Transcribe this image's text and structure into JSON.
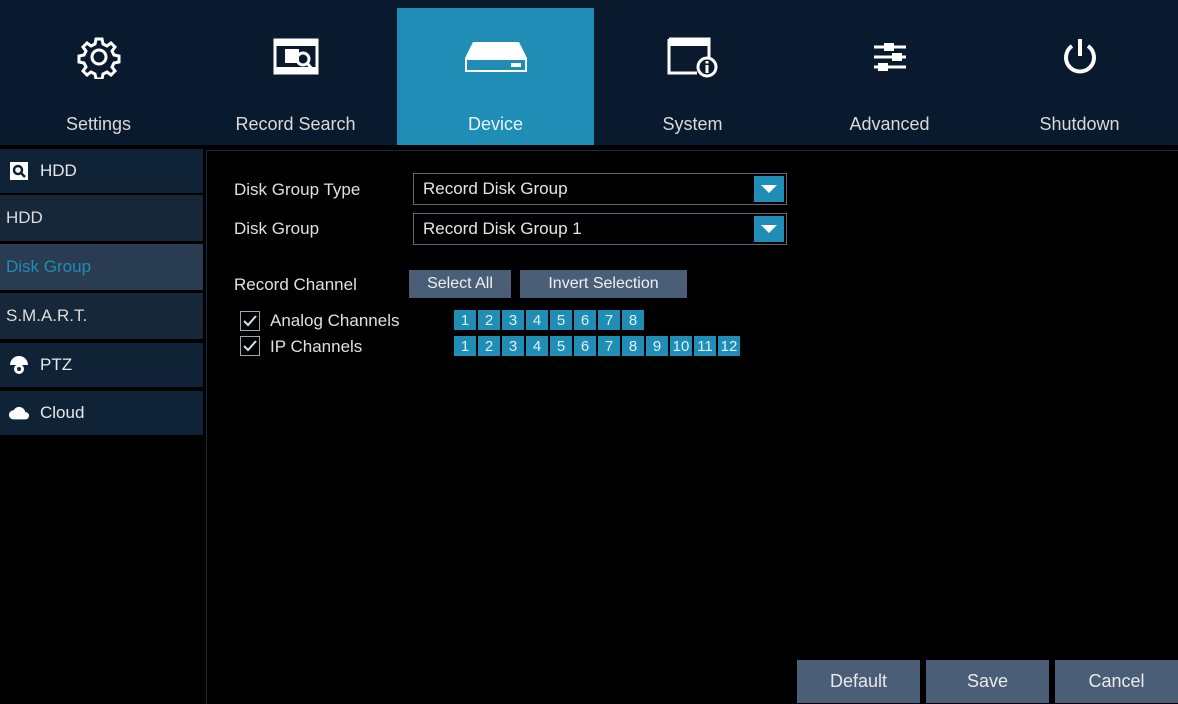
{
  "nav": {
    "tabs": [
      {
        "label": "Settings",
        "icon": "gear-icon"
      },
      {
        "label": "Record Search",
        "icon": "record-search-icon"
      },
      {
        "label": "Device",
        "icon": "hard-drive-icon"
      },
      {
        "label": "System",
        "icon": "system-info-icon"
      },
      {
        "label": "Advanced",
        "icon": "sliders-icon"
      },
      {
        "label": "Shutdown",
        "icon": "power-icon"
      }
    ],
    "active": "Device"
  },
  "sidebar": {
    "groups": [
      {
        "label": "HDD",
        "icon": "hdd-search-icon"
      },
      {
        "label": "PTZ",
        "icon": "ptz-camera-icon"
      },
      {
        "label": "Cloud",
        "icon": "cloud-icon"
      }
    ],
    "hdd_items": [
      "HDD",
      "Disk Group",
      "S.M.A.R.T."
    ],
    "active_item": "Disk Group"
  },
  "form": {
    "disk_group_type_label": "Disk Group Type",
    "disk_group_type_value": "Record Disk Group",
    "disk_group_label": "Disk Group",
    "disk_group_value": "Record Disk Group 1",
    "record_channel_label": "Record Channel",
    "select_all_label": "Select All",
    "invert_selection_label": "Invert Selection",
    "analog_label": "Analog Channels",
    "analog_checked": true,
    "analog_channels": [
      "1",
      "2",
      "3",
      "4",
      "5",
      "6",
      "7",
      "8"
    ],
    "ip_label": "IP Channels",
    "ip_checked": true,
    "ip_channels": [
      "1",
      "2",
      "3",
      "4",
      "5",
      "6",
      "7",
      "8",
      "9",
      "10",
      "11",
      "12"
    ]
  },
  "footer": {
    "default_label": "Default",
    "save_label": "Save",
    "cancel_label": "Cancel"
  },
  "colors": {
    "accent": "#1f8db5",
    "topbar": "#0a1a2e",
    "sidebar_head": "#102236",
    "button": "#4a5f77"
  }
}
